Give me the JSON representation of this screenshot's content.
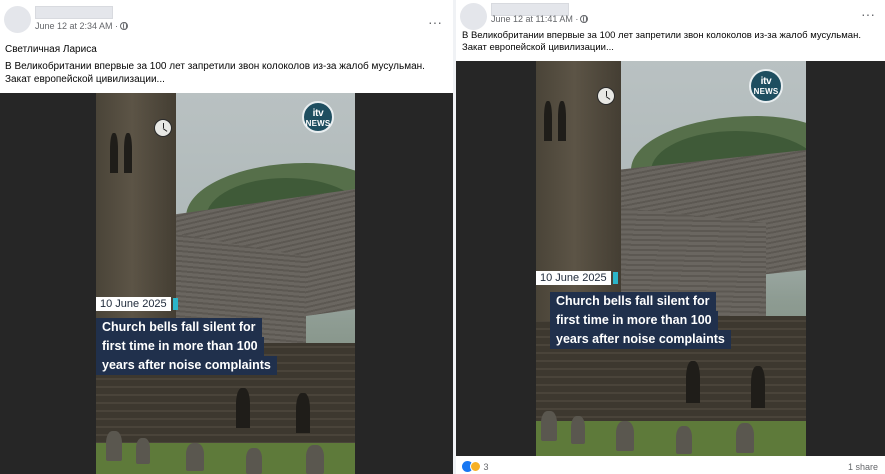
{
  "post_left": {
    "timestamp": "June 12 at 2:34 AM ·",
    "author_line": "Светличная Лариса",
    "text_line1": "В Великобритании впервые за 100 лет запретили звон колоколов из-за жалоб мусульман.",
    "text_line2": "Закат европейской цивилизации...",
    "more_label": "···",
    "video": {
      "logo_line1": "itv",
      "logo_line2": "NEWS",
      "date_tag": "10 June 2025",
      "headline_lines": [
        "Church bells fall silent for",
        "first time in more than 100",
        "years after noise complaints"
      ]
    }
  },
  "post_right": {
    "timestamp": "June 12 at 11:41 AM ·",
    "text_line1": "В Великобритании впервые за 100 лет запретили звон колоколов из-за жалоб мусульман.",
    "text_line2": "Закат европейской цивилизации...",
    "more_label": "···",
    "video": {
      "logo_line1": "itv",
      "logo_line2": "NEWS",
      "date_tag": "10 June 2025",
      "headline_lines": [
        "Church bells fall silent for",
        "first time in more than 100",
        "years after noise complaints"
      ]
    },
    "reaction_count": "3",
    "share_count": "1 share"
  },
  "colors": {
    "headline_bg": "#20304c",
    "date_accent": "#2bb5c9",
    "itv_logo_bg": "#1e4e60",
    "like_blue": "#1877f2"
  },
  "icons": [
    "globe-icon",
    "more-options-icon",
    "itv-news-logo",
    "clock-face",
    "like-reaction-icon",
    "wow-reaction-icon"
  ]
}
